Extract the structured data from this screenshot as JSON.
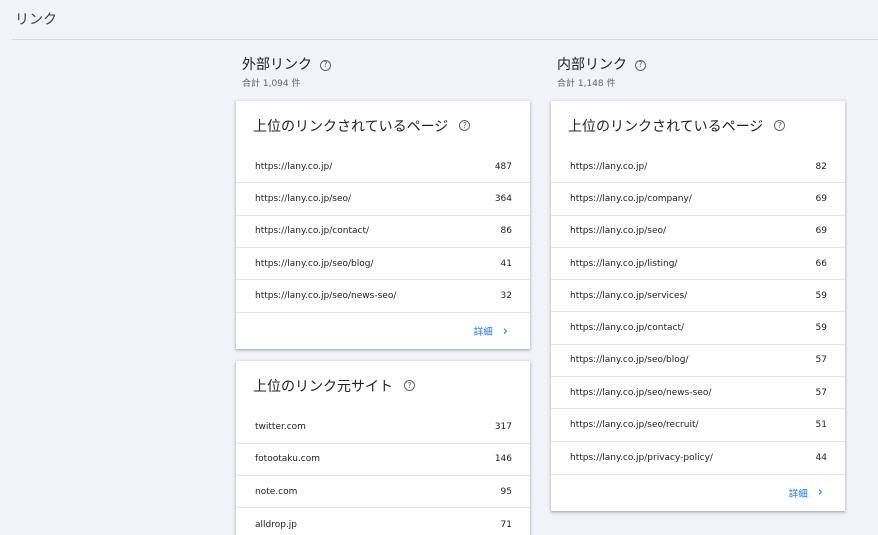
{
  "page": {
    "title": "リンク"
  },
  "external": {
    "title": "外部リンク",
    "total": "合計 1,094 件",
    "top_pages": {
      "title": "上位のリンクされているページ",
      "rows": [
        {
          "url": "https://lany.co.jp/",
          "count": "487"
        },
        {
          "url": "https://lany.co.jp/seo/",
          "count": "364"
        },
        {
          "url": "https://lany.co.jp/contact/",
          "count": "86"
        },
        {
          "url": "https://lany.co.jp/seo/blog/",
          "count": "41"
        },
        {
          "url": "https://lany.co.jp/seo/news-seo/",
          "count": "32"
        }
      ],
      "detail_label": "詳細"
    },
    "top_sites": {
      "title": "上位のリンク元サイト",
      "rows": [
        {
          "url": "twitter.com",
          "count": "317"
        },
        {
          "url": "fotootaku.com",
          "count": "146"
        },
        {
          "url": "note.com",
          "count": "95"
        },
        {
          "url": "alldrop.jp",
          "count": "71"
        }
      ]
    }
  },
  "internal": {
    "title": "内部リンク",
    "total": "合計 1,148 件",
    "top_pages": {
      "title": "上位のリンクされているページ",
      "rows": [
        {
          "url": "https://lany.co.jp/",
          "count": "82"
        },
        {
          "url": "https://lany.co.jp/company/",
          "count": "69"
        },
        {
          "url": "https://lany.co.jp/seo/",
          "count": "69"
        },
        {
          "url": "https://lany.co.jp/listing/",
          "count": "66"
        },
        {
          "url": "https://lany.co.jp/services/",
          "count": "59"
        },
        {
          "url": "https://lany.co.jp/contact/",
          "count": "59"
        },
        {
          "url": "https://lany.co.jp/seo/blog/",
          "count": "57"
        },
        {
          "url": "https://lany.co.jp/seo/news-seo/",
          "count": "57"
        },
        {
          "url": "https://lany.co.jp/seo/recruit/",
          "count": "51"
        },
        {
          "url": "https://lany.co.jp/privacy-policy/",
          "count": "44"
        }
      ],
      "detail_label": "詳細"
    }
  },
  "icons": {
    "help": "help-circle-icon",
    "chevron": "chevron-right-icon"
  },
  "colors": {
    "accent": "#1a73e8",
    "background": "#f1f3f9"
  }
}
